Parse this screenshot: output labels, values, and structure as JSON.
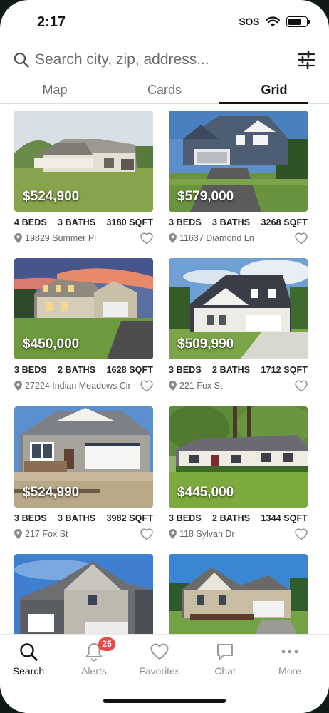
{
  "status": {
    "time": "2:17",
    "sos": "SOS",
    "battery_level": 0.7
  },
  "search": {
    "placeholder": "Search city, zip, address..."
  },
  "tabs": [
    {
      "label": "Map",
      "active": false
    },
    {
      "label": "Cards",
      "active": false
    },
    {
      "label": "Grid",
      "active": true
    }
  ],
  "listings": [
    {
      "price": "$524,900",
      "beds": "4 BEDS",
      "baths": "3 BATHS",
      "sqft": "3180 SQFT",
      "address": "19829 Summer Pl"
    },
    {
      "price": "$579,000",
      "beds": "3 BEDS",
      "baths": "3 BATHS",
      "sqft": "3268 SQFT",
      "address": "11637 Diamond Ln"
    },
    {
      "price": "$450,000",
      "beds": "3 BEDS",
      "baths": "2 BATHS",
      "sqft": "1628 SQFT",
      "address": "27224 Indian Meadows Cir"
    },
    {
      "price": "$509,990",
      "beds": "3 BEDS",
      "baths": "2 BATHS",
      "sqft": "1712 SQFT",
      "address": "221 Fox St"
    },
    {
      "price": "$524,990",
      "beds": "3 BEDS",
      "baths": "3 BATHS",
      "sqft": "3982 SQFT",
      "address": "217 Fox St"
    },
    {
      "price": "$445,000",
      "beds": "3 BEDS",
      "baths": "2 BATHS",
      "sqft": "1344 SQFT",
      "address": "118 Sylvan Dr"
    },
    {
      "price": "",
      "beds": "",
      "baths": "",
      "sqft": "",
      "address": ""
    },
    {
      "price": "",
      "beds": "",
      "baths": "",
      "sqft": "",
      "address": ""
    }
  ],
  "nav": [
    {
      "label": "Search",
      "icon": "search-icon",
      "active": true
    },
    {
      "label": "Alerts",
      "icon": "bell-icon",
      "badge": "25"
    },
    {
      "label": "Favorites",
      "icon": "heart-icon"
    },
    {
      "label": "Chat",
      "icon": "chat-icon"
    },
    {
      "label": "More",
      "icon": "more-icon"
    }
  ],
  "colors": {
    "badge": "#e54b4b",
    "text": "#111111",
    "muted": "#8e8e8e"
  }
}
